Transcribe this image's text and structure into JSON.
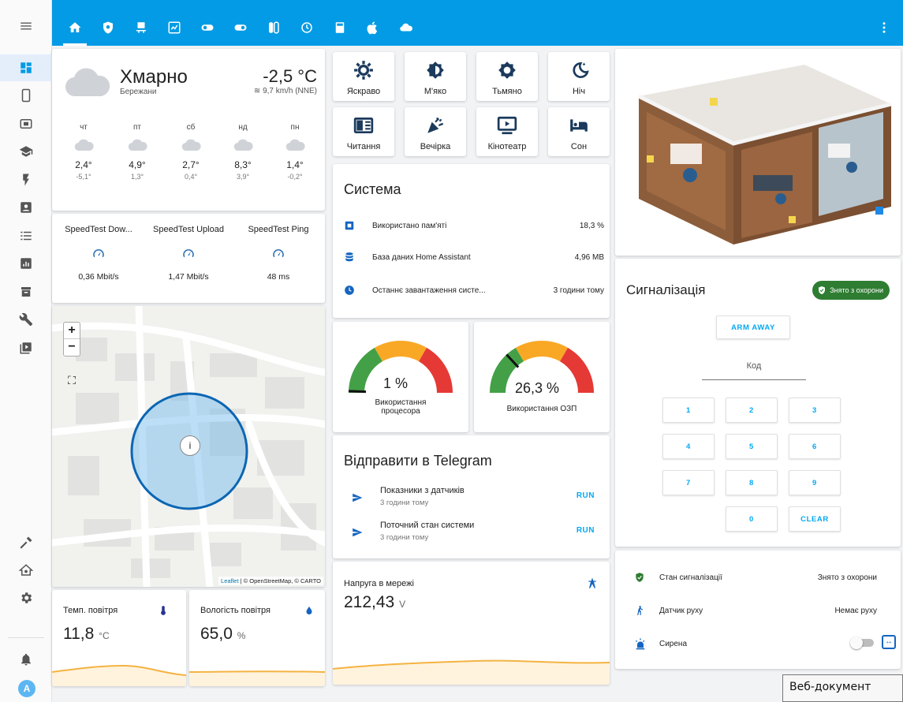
{
  "weather": {
    "condition": "Хмарно",
    "location": "Бережани",
    "temperature": "-2,5 °C",
    "wind": "9,7 km/h (NNE)",
    "forecast": [
      {
        "day": "чт",
        "high": "2,4°",
        "low": "-5,1°"
      },
      {
        "day": "пт",
        "high": "4,9°",
        "low": "1,3°"
      },
      {
        "day": "сб",
        "high": "2,7°",
        "low": "0,4°"
      },
      {
        "day": "нд",
        "high": "8,3°",
        "low": "3,9°"
      },
      {
        "day": "пн",
        "high": "1,4°",
        "low": "-0,2°"
      }
    ]
  },
  "speedtest": [
    {
      "label": "SpeedTest Dow...",
      "value": "0,36 Mbit/s"
    },
    {
      "label": "SpeedTest Upload",
      "value": "1,47 Mbit/s"
    },
    {
      "label": "SpeedTest Ping",
      "value": "48 ms"
    }
  ],
  "map": {
    "zoom_in": "+",
    "zoom_out": "−",
    "zone_marker": "i",
    "attribution_leaflet": "Leaflet",
    "attribution_rest": " | © OpenStreetMap, © CARTO"
  },
  "air": {
    "temp_label": "Темп. повітря",
    "temp_value": "11,8",
    "temp_unit": "°C",
    "hum_label": "Вологість повітря",
    "hum_value": "65,0",
    "hum_unit": "%"
  },
  "scenes": [
    {
      "label": "Яскраво",
      "icon": "brightness-icon"
    },
    {
      "label": "М'яко",
      "icon": "half-contrast-icon"
    },
    {
      "label": "Тьмяно",
      "icon": "dim-icon"
    },
    {
      "label": "Ніч",
      "icon": "night-icon"
    },
    {
      "label": "Читання",
      "icon": "book-icon"
    },
    {
      "label": "Вечірка",
      "icon": "party-icon"
    },
    {
      "label": "Кінотеатр",
      "icon": "cinema-icon"
    },
    {
      "label": "Сон",
      "icon": "bed-icon"
    }
  ],
  "system": {
    "title": "Система",
    "rows": [
      {
        "label": "Використано пам'яті",
        "value": "18,3 %"
      },
      {
        "label": "База даних Home Assistant",
        "value": "4,96 MB"
      },
      {
        "label": "Останнє завантаження систе...",
        "value": "3 години тому"
      }
    ]
  },
  "gauges": [
    {
      "value_text": "1 %",
      "label_line1": "Використання",
      "label_line2": "процесора",
      "fraction": 0.01
    },
    {
      "value_text": "26,3 %",
      "label_line1": "Використання ОЗП",
      "label_line2": "",
      "fraction": 0.263
    }
  ],
  "telegram": {
    "title": "Відправити в Telegram",
    "rows": [
      {
        "name": "Показники з датчиків",
        "time": "3 години тому",
        "action": "RUN"
      },
      {
        "name": "Поточний стан системи",
        "time": "3 години тому",
        "action": "RUN"
      }
    ]
  },
  "voltage": {
    "label": "Напруга в мережі",
    "value": "212,43",
    "unit": "V"
  },
  "alarm": {
    "title": "Сигналізація",
    "badge": "Знято з охорони",
    "arm_away": "ARM AWAY",
    "code_label": "Код",
    "keys": [
      "1",
      "2",
      "3",
      "4",
      "5",
      "6",
      "7",
      "8",
      "9",
      "0",
      "CLEAR"
    ]
  },
  "states": [
    {
      "label": "Стан сигналізації",
      "value": "Знято з охорони"
    },
    {
      "label": "Датчик руху",
      "value": "Немає руху"
    },
    {
      "label": "Сирена",
      "value": ""
    }
  ],
  "tooltip": "Веб-документ",
  "user_initial": "A",
  "colors": {
    "header": "#039be5",
    "accent": "#03a9f4",
    "alarm_green": "#2e7d32",
    "gauge_green": "#43a047",
    "gauge_yellow": "#f9a825",
    "gauge_red": "#e53935"
  }
}
